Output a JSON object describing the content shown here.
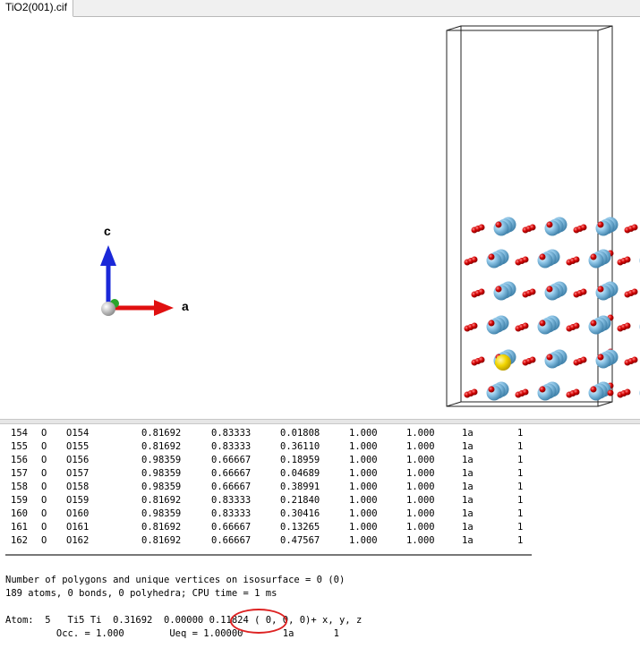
{
  "tab": {
    "title": "TiO2(001).cif"
  },
  "axes": {
    "c_label": "c",
    "a_label": "a"
  },
  "atom_table": {
    "rows": [
      {
        "idx": "154",
        "el": "O",
        "label": "O154",
        "x": "0.81692",
        "y": "0.83333",
        "z": "0.01808",
        "occ": "1.000",
        "u": "1.000",
        "site": "1a",
        "sym": "1"
      },
      {
        "idx": "155",
        "el": "O",
        "label": "O155",
        "x": "0.81692",
        "y": "0.83333",
        "z": "0.36110",
        "occ": "1.000",
        "u": "1.000",
        "site": "1a",
        "sym": "1"
      },
      {
        "idx": "156",
        "el": "O",
        "label": "O156",
        "x": "0.98359",
        "y": "0.66667",
        "z": "0.18959",
        "occ": "1.000",
        "u": "1.000",
        "site": "1a",
        "sym": "1"
      },
      {
        "idx": "157",
        "el": "O",
        "label": "O157",
        "x": "0.98359",
        "y": "0.66667",
        "z": "0.04689",
        "occ": "1.000",
        "u": "1.000",
        "site": "1a",
        "sym": "1"
      },
      {
        "idx": "158",
        "el": "O",
        "label": "O158",
        "x": "0.98359",
        "y": "0.66667",
        "z": "0.38991",
        "occ": "1.000",
        "u": "1.000",
        "site": "1a",
        "sym": "1"
      },
      {
        "idx": "159",
        "el": "O",
        "label": "O159",
        "x": "0.81692",
        "y": "0.83333",
        "z": "0.21840",
        "occ": "1.000",
        "u": "1.000",
        "site": "1a",
        "sym": "1"
      },
      {
        "idx": "160",
        "el": "O",
        "label": "O160",
        "x": "0.98359",
        "y": "0.83333",
        "z": "0.30416",
        "occ": "1.000",
        "u": "1.000",
        "site": "1a",
        "sym": "1"
      },
      {
        "idx": "161",
        "el": "O",
        "label": "O161",
        "x": "0.81692",
        "y": "0.66667",
        "z": "0.13265",
        "occ": "1.000",
        "u": "1.000",
        "site": "1a",
        "sym": "1"
      },
      {
        "idx": "162",
        "el": "O",
        "label": "O162",
        "x": "0.81692",
        "y": "0.66667",
        "z": "0.47567",
        "occ": "1.000",
        "u": "1.000",
        "site": "1a",
        "sym": "1"
      }
    ]
  },
  "messages": {
    "polygons": "Number of polygons and unique vertices on isosurface = 0 (0)",
    "summary": "189 atoms, 0 bonds, 0 polyhedra; CPU time = 1 ms",
    "atom_info_prefix": "Atom:  5   Ti5 Ti  0.31692  0.00000 ",
    "atom_info_z": "0.11824",
    "atom_info_suffix": " ( 0, 0, 0)+ x, y, z",
    "atom_info_line2": "         Occ. = 1.000        Ueq = 1.00000       1a       1"
  },
  "colors": {
    "oxygen": "#d40000",
    "titanium": "#7ab8df",
    "selected": "#f2d600",
    "axis_a": "#e01010",
    "axis_c": "#1a28d8",
    "highlight": "#d22222"
  }
}
